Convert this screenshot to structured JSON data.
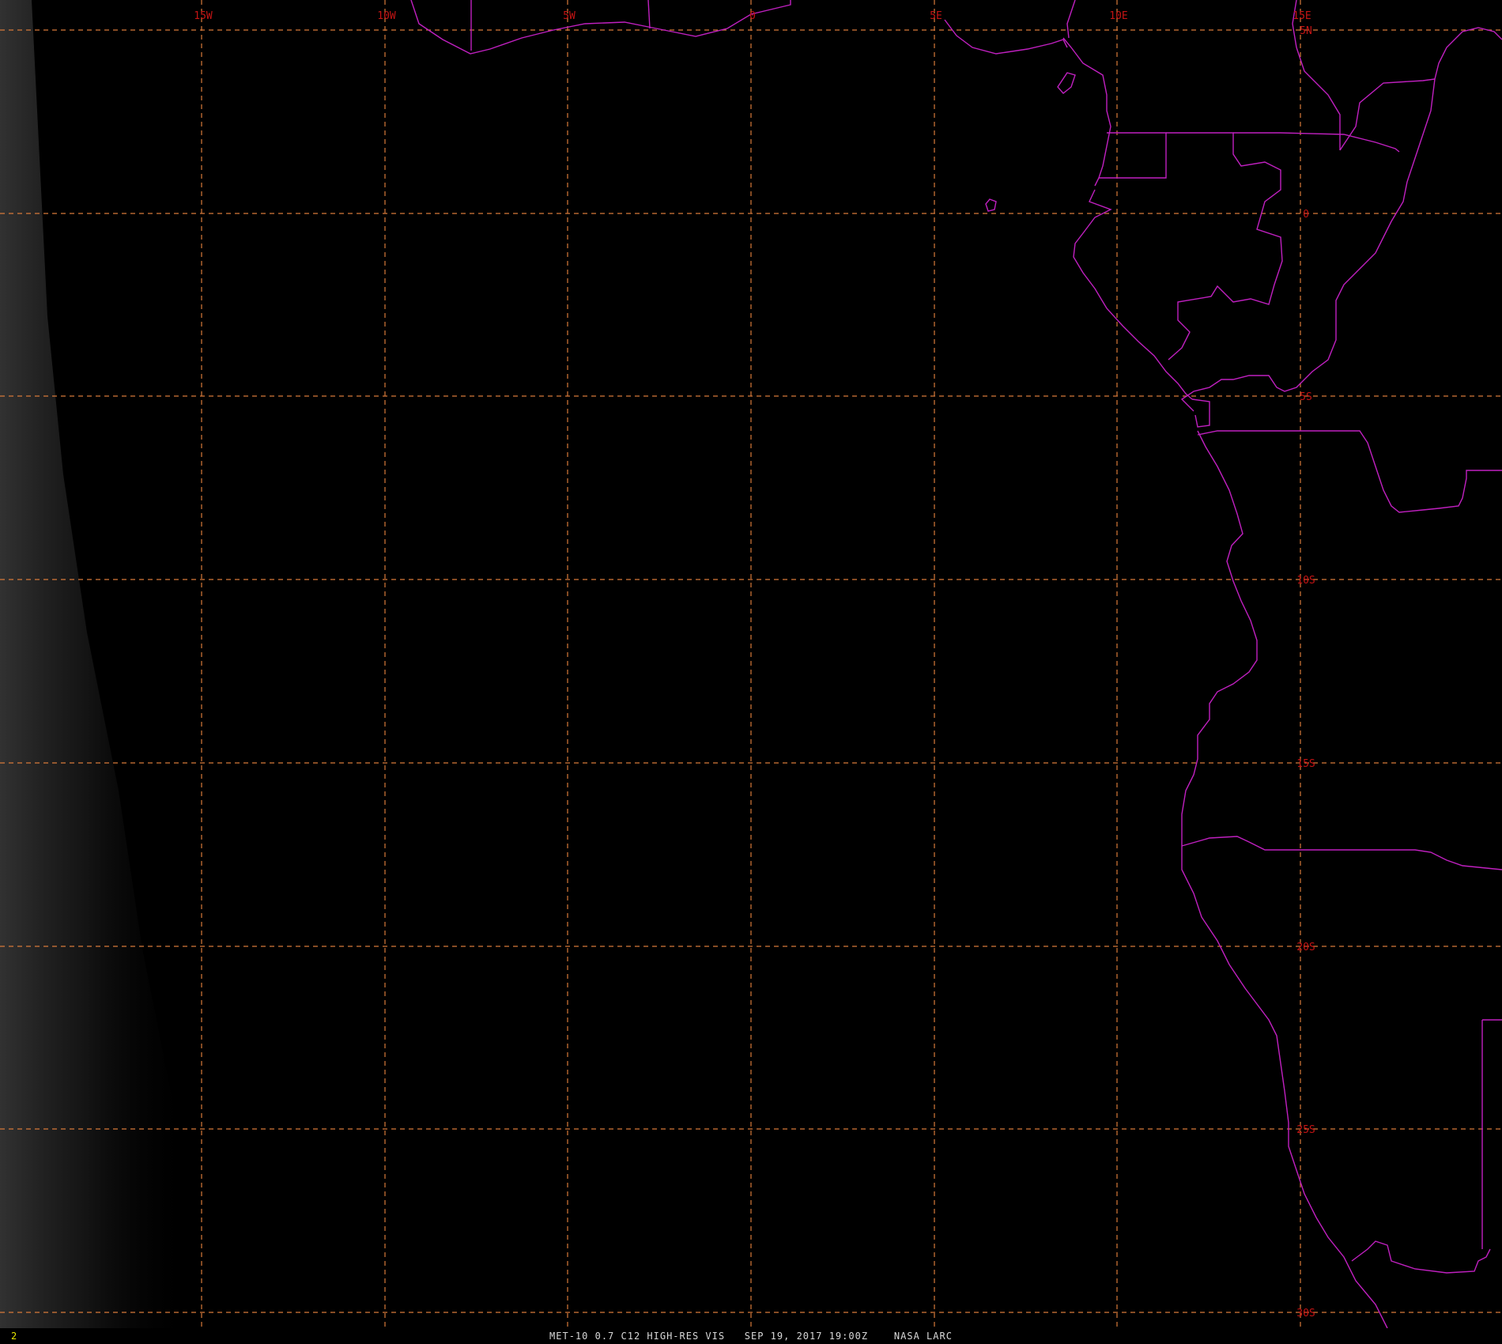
{
  "map": {
    "longitude_labels": [
      "15W",
      "10W",
      "5W",
      "0",
      "5E",
      "10E",
      "15E"
    ],
    "latitude_labels": [
      "5N",
      "0",
      "5S",
      "10S",
      "15S",
      "20S",
      "25S",
      "30S"
    ],
    "colors": {
      "background": "#000000",
      "grid": "#d87a3a",
      "grid_labels": "#c41414",
      "boundaries": "#c020c0",
      "cloud_edge": "#9a9a9a"
    }
  },
  "caption": "MET-10 0.7 C12 HIGH-RES VIS   SEP 19, 2017 19:00Z    NASA LARC",
  "frame_number": "2"
}
